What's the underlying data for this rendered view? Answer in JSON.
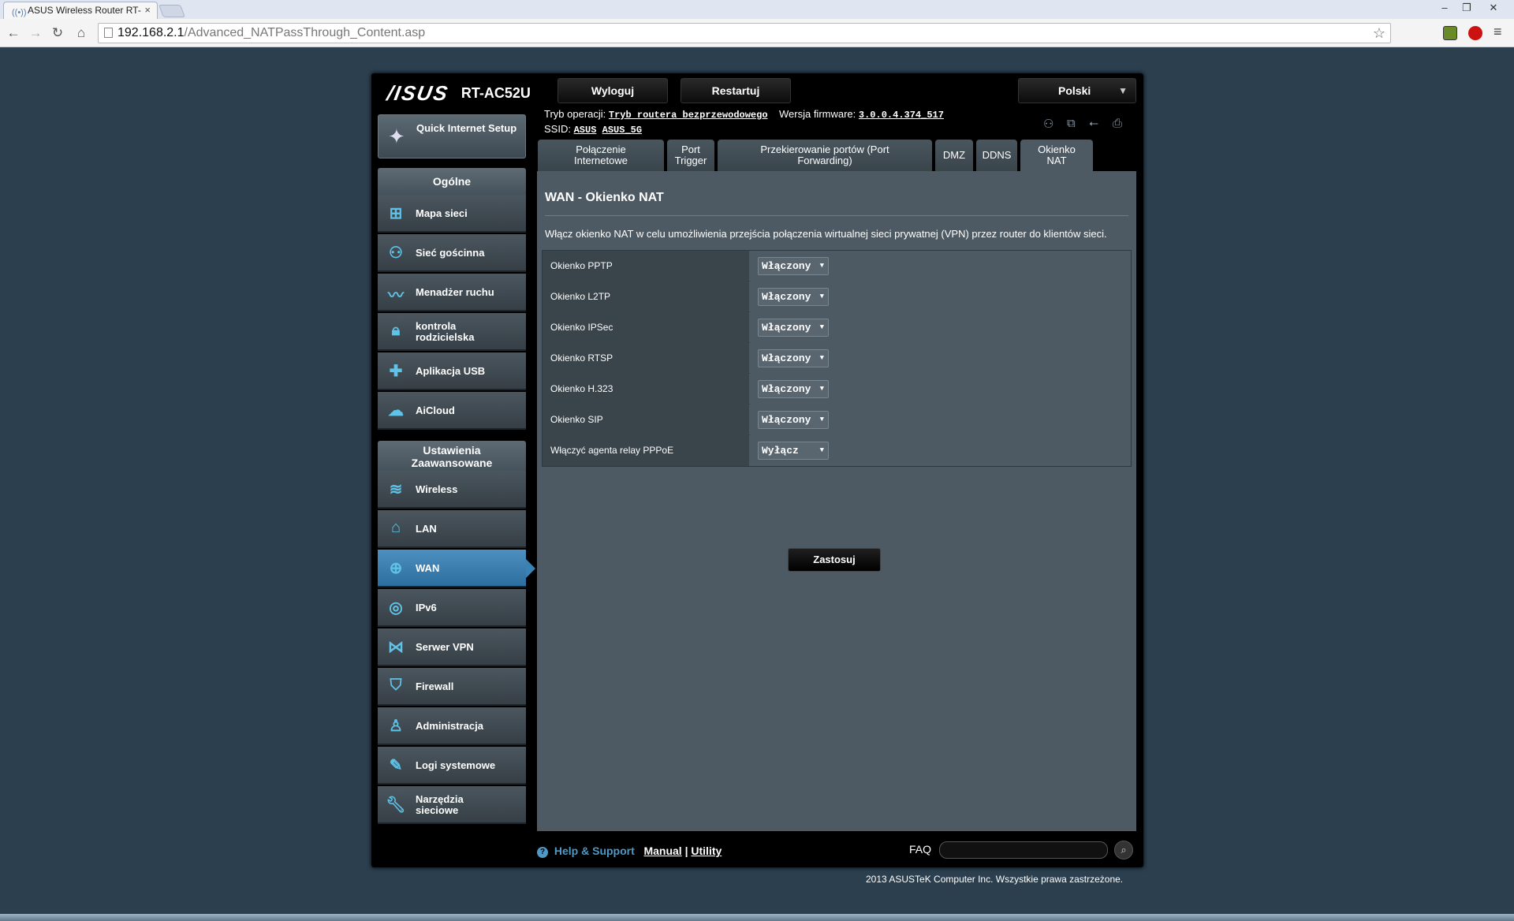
{
  "browser": {
    "tab_title": "ASUS Wireless Router RT-",
    "tab_close": "×",
    "url_host": "192.168.2.1",
    "url_path": "/Advanced_NATPassThrough_Content.asp",
    "minimize": "–",
    "restore": "❐",
    "close": "✕"
  },
  "header": {
    "logo": "/ISUS",
    "model": "RT-AC52U",
    "logout": "Wyloguj",
    "restart": "Restartuj",
    "language": "Polski",
    "op_mode_label": "Tryb operacji:",
    "op_mode_value": "Tryb routera bezprzewodowego",
    "fw_label": "Wersja firmware:",
    "fw_value": "3.0.0.4.374_517",
    "ssid_label": "SSID:",
    "ssid_1": "ASUS",
    "ssid_2": "ASUS_5G"
  },
  "sidebar": {
    "qis": "Quick Internet Setup",
    "general_head": "Ogólne",
    "general": [
      {
        "label": "Mapa sieci",
        "icon": "network-map-icon"
      },
      {
        "label": "Sieć gościnna",
        "icon": "guest-network-icon"
      },
      {
        "label": "Menadżer ruchu",
        "icon": "traffic-manager-icon"
      },
      {
        "label": "kontrola rodzicielska",
        "icon": "lock-icon"
      },
      {
        "label": "Aplikacja USB",
        "icon": "puzzle-icon"
      },
      {
        "label": "AiCloud",
        "icon": "cloud-icon"
      }
    ],
    "advanced_head": "Ustawienia Zaawansowane",
    "advanced": [
      {
        "label": "Wireless",
        "icon": "wifi-icon"
      },
      {
        "label": "LAN",
        "icon": "home-icon"
      },
      {
        "label": "WAN",
        "icon": "globe-icon"
      },
      {
        "label": "IPv6",
        "icon": "ipv6-icon"
      },
      {
        "label": "Serwer VPN",
        "icon": "vpn-icon"
      },
      {
        "label": "Firewall",
        "icon": "shield-icon"
      },
      {
        "label": "Administracja",
        "icon": "user-icon"
      },
      {
        "label": "Logi systemowe",
        "icon": "log-icon"
      },
      {
        "label": "Narzędzia sieciowe",
        "icon": "wrench-icon"
      }
    ]
  },
  "tabs": [
    "Połączenie Internetowe",
    "Port Trigger",
    "Przekierowanie portów (Port Forwarding)",
    "DMZ",
    "DDNS",
    "Okienko NAT"
  ],
  "content": {
    "title": "WAN - Okienko NAT",
    "description": "Włącz okienko NAT w celu umożliwienia przejścia połączenia wirtualnej sieci prywatnej (VPN) przez router do klientów sieci.",
    "rows": [
      {
        "label": "Okienko PPTP",
        "value": "Włączony"
      },
      {
        "label": "Okienko L2TP",
        "value": "Włączony"
      },
      {
        "label": "Okienko IPSec",
        "value": "Włączony"
      },
      {
        "label": "Okienko RTSP",
        "value": "Włączony"
      },
      {
        "label": "Okienko H.323",
        "value": "Włączony"
      },
      {
        "label": "Okienko SIP",
        "value": "Włączony"
      },
      {
        "label": "Włączyć agenta relay PPPoE",
        "value": "Wyłącz"
      }
    ],
    "apply": "Zastosuj"
  },
  "footer": {
    "help": "Help & Support",
    "manual": "Manual",
    "sep": "|",
    "utility": "Utility",
    "faq": "FAQ",
    "copyright": "2013 ASUSTeK Computer Inc. Wszystkie prawa zastrzeżone."
  }
}
